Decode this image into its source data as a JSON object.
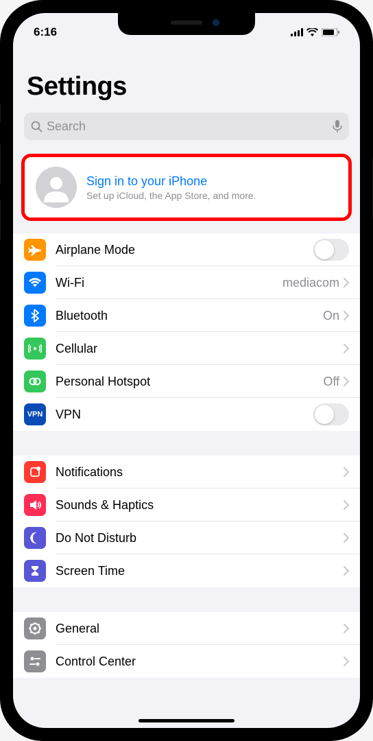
{
  "status": {
    "time": "6:16"
  },
  "header": {
    "title": "Settings"
  },
  "search": {
    "placeholder": "Search"
  },
  "signin": {
    "title": "Sign in to your iPhone",
    "subtitle": "Set up iCloud, the App Store, and more."
  },
  "group1": {
    "airplane": "Airplane Mode",
    "wifi": "Wi-Fi",
    "wifi_detail": "mediacom",
    "bluetooth": "Bluetooth",
    "bluetooth_detail": "On",
    "cellular": "Cellular",
    "hotspot": "Personal Hotspot",
    "hotspot_detail": "Off",
    "vpn": "VPN"
  },
  "group2": {
    "notifications": "Notifications",
    "sounds": "Sounds & Haptics",
    "dnd": "Do Not Disturb",
    "screentime": "Screen Time"
  },
  "group3": {
    "general": "General",
    "control": "Control Center"
  }
}
